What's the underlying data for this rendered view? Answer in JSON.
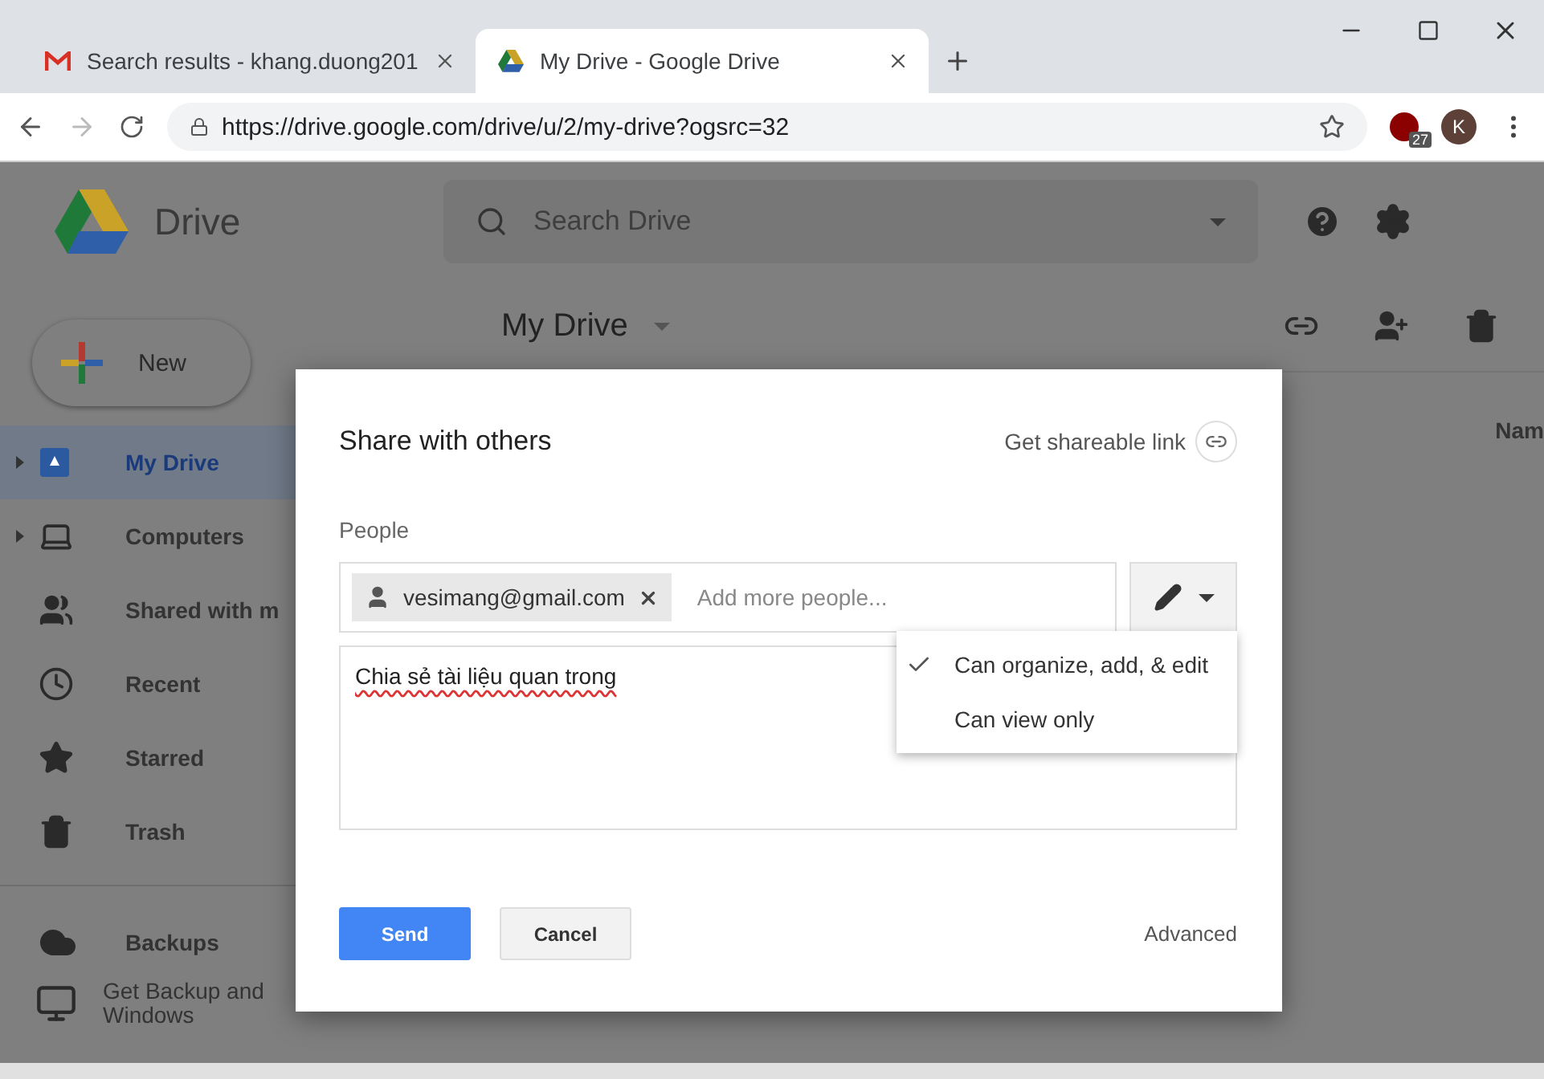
{
  "browser": {
    "tabs": [
      {
        "title": "Search results - khang.duong201",
        "kind": "mail",
        "selected": false
      },
      {
        "title": "My Drive - Google Drive",
        "kind": "drive",
        "selected": true
      }
    ],
    "url": "https://drive.google.com/drive/u/2/my-drive?ogsrc=32",
    "extension_badge": "27",
    "profile_initial": "K"
  },
  "drive": {
    "app_name": "Drive",
    "search": {
      "placeholder": "Search Drive"
    },
    "breadcrumb": "My Drive",
    "new_button": "New",
    "sidebar": {
      "items": [
        {
          "label": "My Drive",
          "kind": "drive",
          "expandable": true,
          "selected": true
        },
        {
          "label": "Computers",
          "kind": "computers",
          "expandable": true,
          "selected": false
        },
        {
          "label": "Shared with m",
          "kind": "shared",
          "expandable": false,
          "selected": false
        },
        {
          "label": "Recent",
          "kind": "recent",
          "expandable": false,
          "selected": false
        },
        {
          "label": "Starred",
          "kind": "starred",
          "expandable": false,
          "selected": false
        },
        {
          "label": "Trash",
          "kind": "trash",
          "expandable": false,
          "selected": false
        }
      ],
      "backups": "Backups",
      "promo_lines": [
        "Get Backup and",
        "Windows"
      ]
    },
    "column_header": "Nam"
  },
  "dialog": {
    "title": "Share with others",
    "shareable_link": "Get shareable link",
    "people_label": "People",
    "chips": [
      {
        "email": "vesimang@gmail.com"
      }
    ],
    "add_placeholder": "Add more people...",
    "message": "Chia sẻ tài liệu quan trong",
    "permission_menu": [
      {
        "label": "Can organize, add, & edit",
        "selected": true
      },
      {
        "label": "Can view only",
        "selected": false
      }
    ],
    "send": "Send",
    "cancel": "Cancel",
    "advanced": "Advanced"
  }
}
